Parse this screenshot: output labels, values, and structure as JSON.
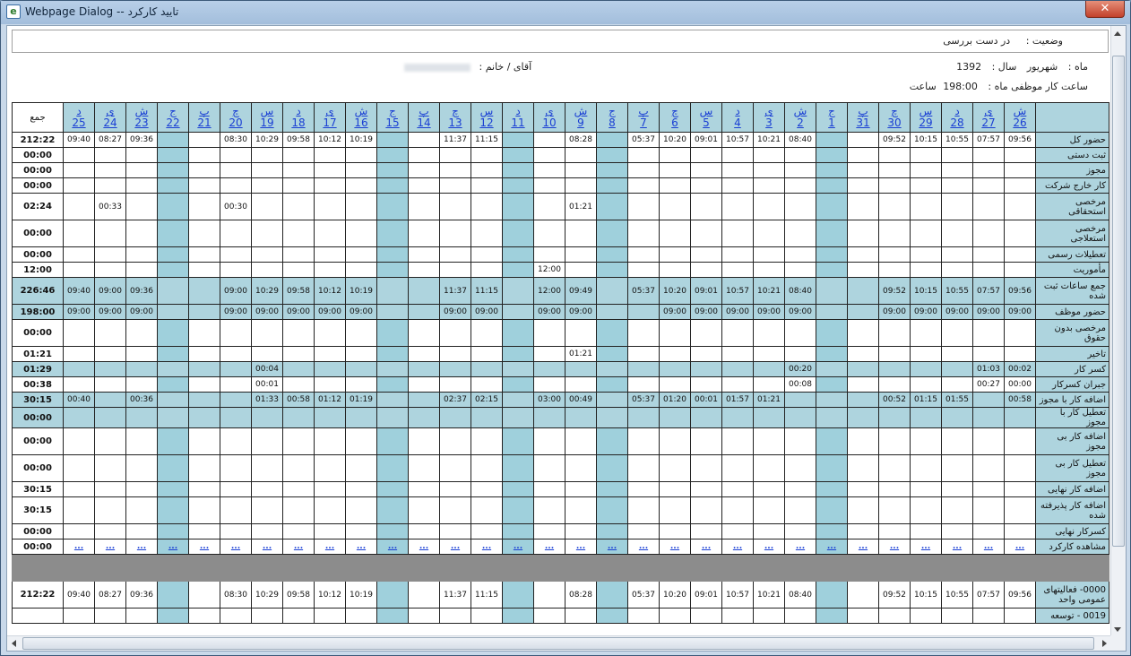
{
  "window": {
    "title": "Webpage Dialog -- تایید کارکرد",
    "close": "✕"
  },
  "status": {
    "label": "وضعیت :",
    "value": "در دست بررسی"
  },
  "month": {
    "label": "ماه :",
    "value": "شهریور",
    "year_label": "سال :",
    "year": "1392"
  },
  "person": {
    "label": "آقای / خانم :"
  },
  "hours": {
    "label": "ساعت کار موظفی ماه :",
    "value": "198:00",
    "unit": "ساعت"
  },
  "table": {
    "total_header": "جمع",
    "days": [
      {
        "name": "ش",
        "num": "26"
      },
      {
        "name": "ی",
        "num": "27"
      },
      {
        "name": "د",
        "num": "28"
      },
      {
        "name": "س",
        "num": "29"
      },
      {
        "name": "چ",
        "num": "30"
      },
      {
        "name": "پ",
        "num": "31"
      },
      {
        "name": "ج",
        "num": "1",
        "off": true
      },
      {
        "name": "ش",
        "num": "2"
      },
      {
        "name": "ی",
        "num": "3"
      },
      {
        "name": "د",
        "num": "4"
      },
      {
        "name": "س",
        "num": "5"
      },
      {
        "name": "چ",
        "num": "6"
      },
      {
        "name": "پ",
        "num": "7"
      },
      {
        "name": "ج",
        "num": "8",
        "off": true
      },
      {
        "name": "ش",
        "num": "9"
      },
      {
        "name": "ی",
        "num": "10"
      },
      {
        "name": "د",
        "num": "11",
        "off": true
      },
      {
        "name": "س",
        "num": "12"
      },
      {
        "name": "چ",
        "num": "13"
      },
      {
        "name": "پ",
        "num": "14"
      },
      {
        "name": "ج",
        "num": "15",
        "off": true
      },
      {
        "name": "ش",
        "num": "16"
      },
      {
        "name": "ی",
        "num": "17"
      },
      {
        "name": "د",
        "num": "18"
      },
      {
        "name": "س",
        "num": "19"
      },
      {
        "name": "چ",
        "num": "20"
      },
      {
        "name": "پ",
        "num": "21"
      },
      {
        "name": "ج",
        "num": "22",
        "off": true
      },
      {
        "name": "ش",
        "num": "23"
      },
      {
        "name": "ی",
        "num": "24"
      },
      {
        "name": "د",
        "num": "25"
      }
    ],
    "rows": [
      {
        "label": "حضور کل",
        "total": "212:22",
        "cells": {
          "0": "09:56",
          "1": "07:57",
          "2": "10:55",
          "3": "10:15",
          "4": "09:52",
          "7": "08:40",
          "8": "10:21",
          "9": "10:57",
          "10": "09:01",
          "11": "10:20",
          "12": "05:37",
          "14": "08:28",
          "17": "11:15",
          "18": "11:37",
          "21": "10:19",
          "22": "10:12",
          "23": "09:58",
          "24": "10:29",
          "25": "08:30",
          "28": "09:36",
          "29": "08:27",
          "30": "09:40"
        }
      },
      {
        "label": "ثبت دستی",
        "total": "00:00",
        "cells": {}
      },
      {
        "label": "مجوز",
        "total": "00:00",
        "cells": {}
      },
      {
        "label": "کار خارج شرکت",
        "total": "00:00",
        "cells": {}
      },
      {
        "label": "مرخصی استحقاقی",
        "total": "02:24",
        "cells": {
          "14": "01:21",
          "25": "00:30",
          "29": "00:33"
        }
      },
      {
        "label": "مرخصی استعلاجی",
        "total": "00:00",
        "cells": {}
      },
      {
        "label": "تعطیلات رسمی",
        "total": "00:00",
        "cells": {}
      },
      {
        "label": "مأموریت",
        "total": "12:00",
        "cells": {
          "15": "12:00"
        }
      },
      {
        "label": "جمع ساعات ثبت شده",
        "total": "226:46",
        "hl": true,
        "cells": {
          "0": "09:56",
          "1": "07:57",
          "2": "10:55",
          "3": "10:15",
          "4": "09:52",
          "7": "08:40",
          "8": "10:21",
          "9": "10:57",
          "10": "09:01",
          "11": "10:20",
          "12": "05:37",
          "14": "09:49",
          "15": "12:00",
          "17": "11:15",
          "18": "11:37",
          "21": "10:19",
          "22": "10:12",
          "23": "09:58",
          "24": "10:29",
          "25": "09:00",
          "28": "09:36",
          "29": "09:00",
          "30": "09:40"
        }
      },
      {
        "label": "حضور موظف",
        "total": "198:00",
        "hl": true,
        "cells": {
          "0": "09:00",
          "1": "09:00",
          "2": "09:00",
          "3": "09:00",
          "4": "09:00",
          "7": "09:00",
          "8": "09:00",
          "9": "09:00",
          "10": "09:00",
          "11": "09:00",
          "14": "09:00",
          "15": "09:00",
          "17": "09:00",
          "18": "09:00",
          "21": "09:00",
          "22": "09:00",
          "23": "09:00",
          "24": "09:00",
          "25": "09:00",
          "28": "09:00",
          "29": "09:00",
          "30": "09:00"
        }
      },
      {
        "label": "مرخصی بدون حقوق",
        "total": "00:00",
        "cells": {}
      },
      {
        "label": "تاخیر",
        "total": "01:21",
        "cells": {
          "14": "01:21"
        }
      },
      {
        "label": "کسر کار",
        "total": "01:29",
        "hl": true,
        "cells": {
          "0": "00:02",
          "1": "01:03",
          "7": "00:20",
          "24": "00:04"
        }
      },
      {
        "label": "جبران کسرکار",
        "total": "00:38",
        "cells": {
          "0": "00:00",
          "1": "00:27",
          "7": "00:08",
          "24": "00:01"
        }
      },
      {
        "label": "اضافه کار با مجوز",
        "total": "30:15",
        "hl": true,
        "cells": {
          "0": "00:58",
          "2": "01:55",
          "3": "01:15",
          "4": "00:52",
          "8": "01:21",
          "9": "01:57",
          "10": "00:01",
          "11": "01:20",
          "12": "05:37",
          "14": "00:49",
          "15": "03:00",
          "17": "02:15",
          "18": "02:37",
          "21": "01:19",
          "22": "01:12",
          "23": "00:58",
          "24": "01:33",
          "28": "00:36",
          "30": "00:40"
        }
      },
      {
        "label": "تعطیل کار با مجوز",
        "total": "00:00",
        "hl": true,
        "cells": {}
      },
      {
        "label": "اضافه کار بی مجوز",
        "total": "00:00",
        "cells": {}
      },
      {
        "label": "تعطیل کار بی مجوز",
        "total": "00:00",
        "cells": {}
      },
      {
        "label": "اضافه کار نهایی",
        "total": "30:15",
        "cells": {}
      },
      {
        "label": "اضافه کار پذیرفته شده",
        "total": "30:15",
        "cells": {}
      },
      {
        "label": "کسرکار نهایی",
        "total": "00:00",
        "cells": {}
      },
      {
        "label": "مشاهده کارکرد",
        "total": "00:00",
        "link": "...",
        "cells": {}
      }
    ],
    "bottom_rows": [
      {
        "label": "0000- فعالیتهای عمومی واحد",
        "total": "212:22",
        "cells": {
          "0": "09:56",
          "1": "07:57",
          "2": "10:55",
          "3": "10:15",
          "4": "09:52",
          "7": "08:40",
          "8": "10:21",
          "9": "10:57",
          "10": "09:01",
          "11": "10:20",
          "12": "05:37",
          "14": "08:28",
          "17": "11:15",
          "18": "11:37",
          "21": "10:19",
          "22": "10:12",
          "23": "09:58",
          "24": "10:29",
          "25": "08:30",
          "28": "09:36",
          "29": "08:27",
          "30": "09:40"
        }
      },
      {
        "label": "0019 - توسعه",
        "total": "",
        "cells": {}
      }
    ]
  }
}
